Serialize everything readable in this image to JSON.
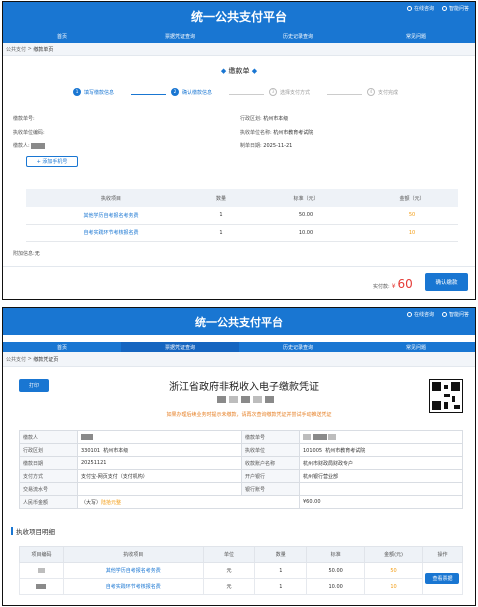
{
  "app_title": "统一公共支付平台",
  "header_links": {
    "service": "在线咨询",
    "help": "智能问答"
  },
  "nav": [
    "首页",
    "票据凭证查询",
    "历史记录查询",
    "常见问题"
  ],
  "screen1": {
    "breadcrumb": {
      "parent": "公共支付",
      "sep": " > ",
      "current": "缴款单页"
    },
    "section_title": "缴款单",
    "steps": [
      {
        "num": "1",
        "label": "填写缴款信息",
        "state": "done"
      },
      {
        "num": "2",
        "label": "确认缴款信息",
        "state": "done"
      },
      {
        "num": "3",
        "label": "选择支付方式",
        "state": "todo"
      },
      {
        "num": "4",
        "label": "支付完成",
        "state": "todo"
      }
    ],
    "info_left": [
      {
        "label": "缴款单号:",
        "value": ""
      },
      {
        "label": "执收单位编码:",
        "value": ""
      },
      {
        "label": "缴款人:",
        "value": ""
      }
    ],
    "info_right": [
      {
        "label": "行政区划:",
        "value": "杭州市本级"
      },
      {
        "label": "执收单位名称:",
        "value": "杭州市教育考试院"
      },
      {
        "label": "制单日期:",
        "value": "2025-11-21"
      }
    ],
    "add_phone_label": "+ 添加手机号",
    "table_headers": [
      "执收项目",
      "数量",
      "标准（元）",
      "金额（元）"
    ],
    "rows": [
      {
        "item": "其他学历自考报名考务费",
        "qty": "1",
        "std": "50.00",
        "amount": "50"
      },
      {
        "item": "自考实践环节考核报名费",
        "qty": "1",
        "std": "10.00",
        "amount": "10"
      }
    ],
    "extra_label": "附加信息:",
    "extra_value": "无",
    "paid_label": "实付款:",
    "paid_currency": "¥",
    "paid_amount": "60",
    "confirm_btn": "确认缴款"
  },
  "screen2": {
    "breadcrumb": {
      "parent": "公共支付",
      "sep": " > ",
      "current": "缴款凭证页"
    },
    "print_btn": "打印",
    "doc_title": "浙江省政府非税收入电子缴款凭证",
    "notice": "如果办理后续业务时提示未缴款，请再次查询缴款凭证并尝试手动推送凭证",
    "info_rows": [
      {
        "k1": "缴款人",
        "v1": "",
        "k2": "缴款单号",
        "v2": ""
      },
      {
        "k1": "行政区划",
        "v1": "330101  杭州市本级",
        "k2": "执收单位",
        "v2": "101005  杭州市教育考试院"
      },
      {
        "k1": "缴款日期",
        "v1": "20251121",
        "k2": "收款账户名称",
        "v2": "杭州市财政局财政专户"
      },
      {
        "k1": "支付方式",
        "v1": "支付宝-网页支付（支付机构）",
        "k2": "开户银行",
        "v2": "杭州银行营业部"
      },
      {
        "k1": "交易流水号",
        "v1": "",
        "k2": "银行账号",
        "v2": ""
      }
    ],
    "rmb_label": "人民币金额",
    "rmb_words_prefix": "（大写）",
    "rmb_words": "陆拾元整",
    "rmb_value": "¥60.00",
    "detail_title": "执收项目明细",
    "detail_headers": [
      "项目编码",
      "执收项目",
      "单位",
      "数量",
      "标准",
      "金额(元)",
      "操作"
    ],
    "detail_rows": [
      {
        "item": "其他学历自考报名考务费",
        "unit": "元",
        "qty": "1",
        "std": "50.00",
        "amount": "50"
      },
      {
        "item": "自考实践环节考核报名费",
        "unit": "元",
        "qty": "1",
        "std": "10.00",
        "amount": "10"
      }
    ],
    "view_btn": "查看票据"
  },
  "colors": {
    "primary": "#1976d2",
    "accent_orange": "#f39c12",
    "price_red": "#e53935",
    "notice_orange": "#e67e22"
  }
}
